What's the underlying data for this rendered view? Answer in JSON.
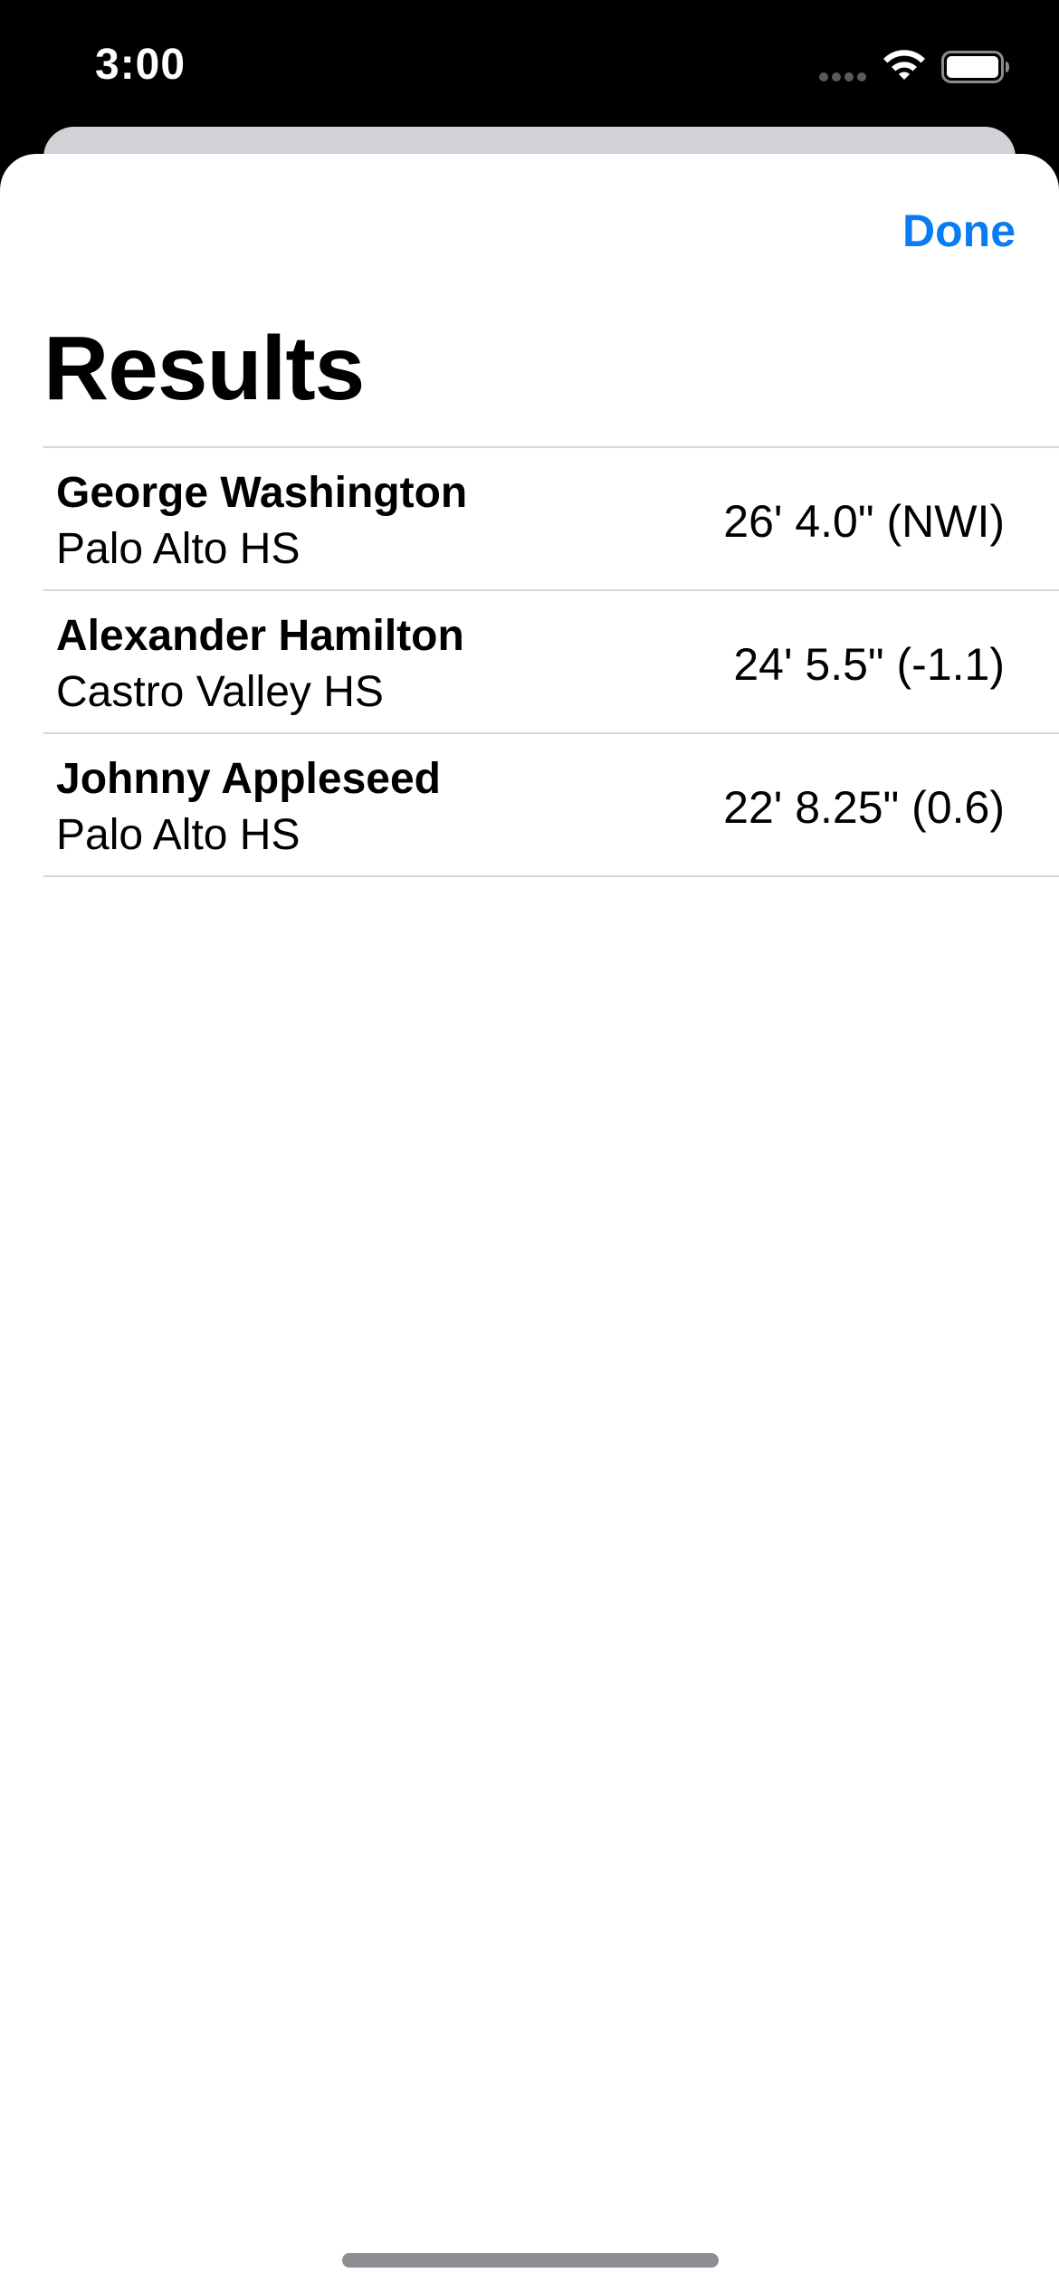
{
  "status_bar": {
    "time": "3:00",
    "icons": [
      "signal-dots-icon",
      "wifi-icon",
      "battery-icon"
    ]
  },
  "sheet": {
    "done_label": "Done",
    "title": "Results"
  },
  "results": [
    {
      "name": "George Washington",
      "school": "Palo Alto HS",
      "mark": "26' 4.0\" (NWI)"
    },
    {
      "name": "Alexander Hamilton",
      "school": "Castro Valley HS",
      "mark": "24' 5.5\" (-1.1)"
    },
    {
      "name": "Johnny Appleseed",
      "school": "Palo Alto HS",
      "mark": "22' 8.25\" (0.6)"
    }
  ],
  "colors": {
    "accent": "#0a7cf2",
    "background": "#000000",
    "sheet": "#ffffff",
    "separator": "#d6d6d8"
  }
}
